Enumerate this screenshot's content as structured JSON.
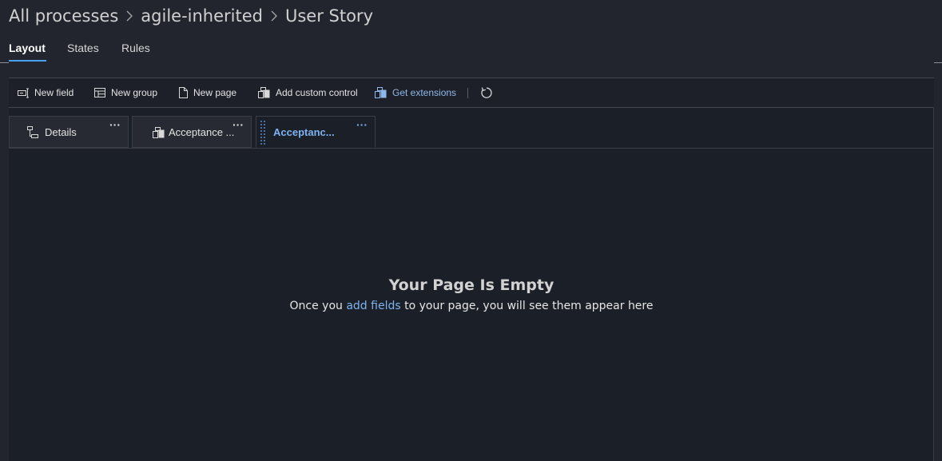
{
  "breadcrumb": {
    "items": [
      "All processes",
      "agile-inherited",
      "User Story"
    ]
  },
  "top_tabs": [
    "Layout",
    "States",
    "Rules"
  ],
  "toolbar": {
    "new_field": "New field",
    "new_group": "New group",
    "new_page": "New page",
    "add_custom_control": "Add custom control",
    "get_extensions": "Get extensions",
    "refresh_icon": "refresh-icon"
  },
  "page_tabs": [
    {
      "label": "Details",
      "icon": "tree-icon"
    },
    {
      "label": "Acceptance ...",
      "icon": "extension-icon"
    },
    {
      "label": "Acceptanc...",
      "icon": "drag-handle-icon"
    }
  ],
  "empty_state": {
    "title": "Your Page Is Empty",
    "before_link": "Once you",
    "link": "add fields",
    "after_link": "to your page, you will see them appear here"
  },
  "colors": {
    "background": "#1b1f28",
    "accent": "#7fb2f0",
    "tab_underline": "#4aa0f0"
  }
}
